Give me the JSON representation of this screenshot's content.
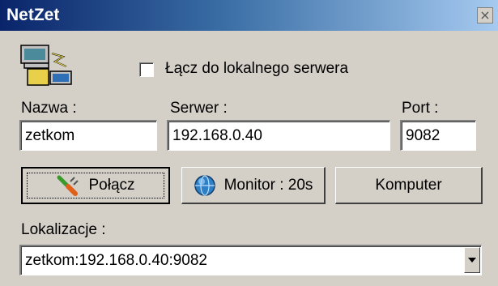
{
  "window": {
    "title": "NetZet",
    "close_glyph": "×"
  },
  "icons": {
    "app": "network-computers-icon",
    "connect": "plug-icon",
    "monitor": "globe-icon",
    "dropdown": "triangle-down-icon"
  },
  "options": {
    "local_server_label": "Łącz do lokalnego serwera",
    "local_server_checked": false
  },
  "fields": {
    "name": {
      "label": "Nazwa :",
      "value": "zetkom"
    },
    "server": {
      "label": "Serwer :",
      "value": "192.168.0.40"
    },
    "port": {
      "label": "Port :",
      "value": "9082"
    }
  },
  "buttons": {
    "connect": "Połącz",
    "monitor": "Monitor : 20s",
    "computer": "Komputer"
  },
  "locations": {
    "label": "Lokalizacje :",
    "selected": "zetkom:192.168.0.40:9082"
  }
}
